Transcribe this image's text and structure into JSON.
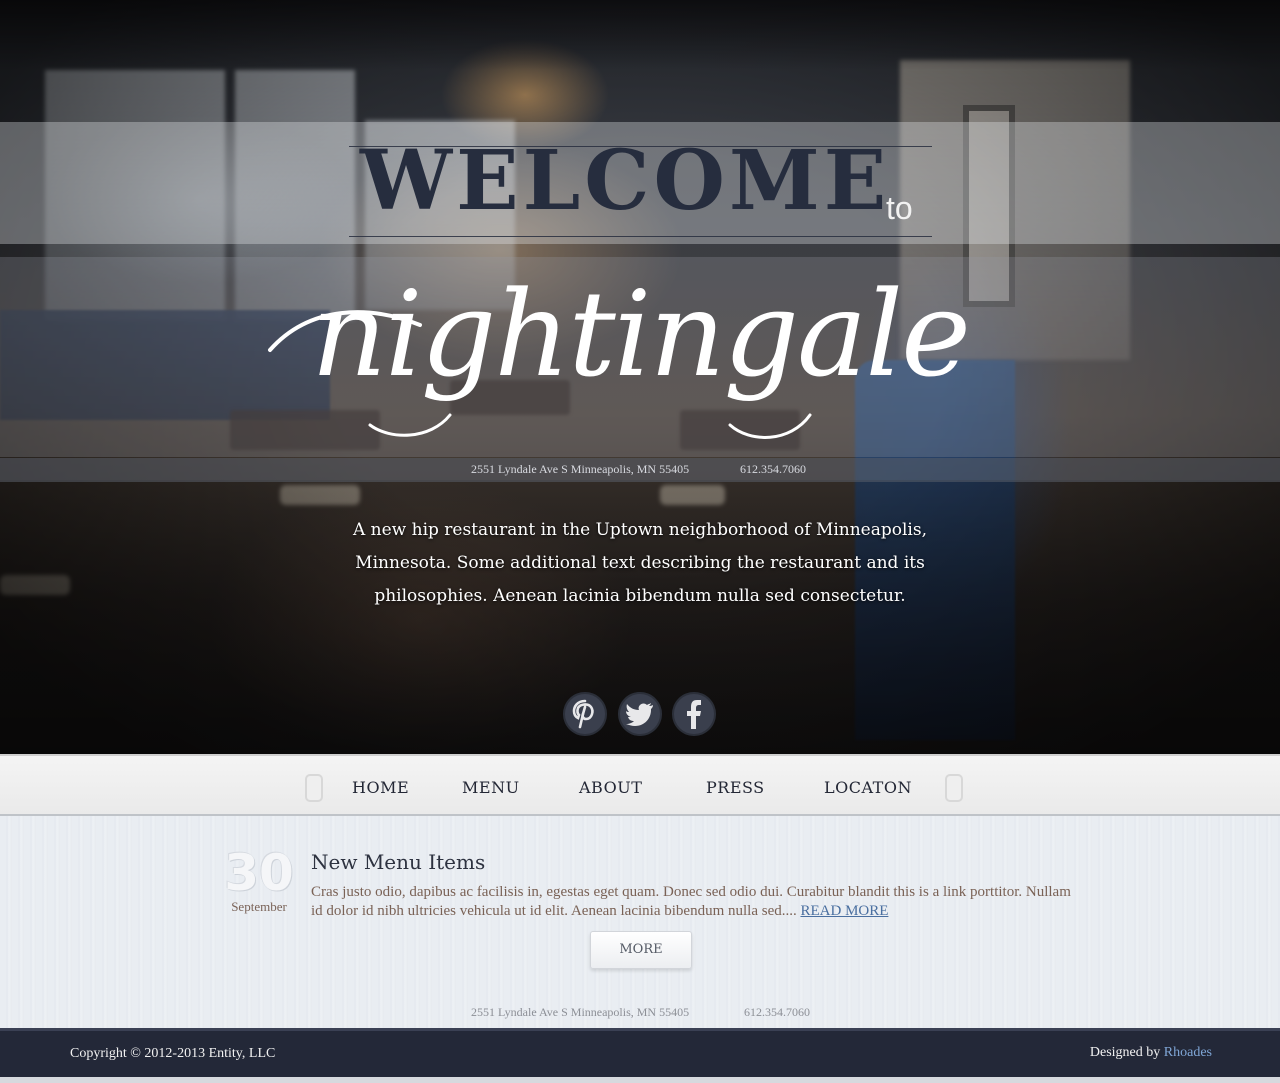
{
  "hero": {
    "welcome": "WELCOME",
    "to": "to",
    "brand_script": "nightingale",
    "address": "2551 Lyndale Ave S Minneapolis, MN 55405",
    "phone": "612.354.7060",
    "tagline_lines": [
      "A new hip restaurant in the Uptown neighborhood of Minneapolis,",
      "Minnesota. Some additional text describing the restaurant and its",
      "philosophies. Aenean lacinia bibendum nulla sed consectetur."
    ]
  },
  "social": [
    {
      "name": "pinterest-icon",
      "glyph": "P"
    },
    {
      "name": "twitter-icon",
      "glyph": "bird"
    },
    {
      "name": "facebook-icon",
      "glyph": "f"
    }
  ],
  "nav": {
    "items": [
      "HOME",
      "MENU",
      "ABOUT",
      "PRESS",
      "LOCATON"
    ]
  },
  "post": {
    "day": "30",
    "month": "September",
    "title": "New Menu Items",
    "body": "Cras justo odio, dapibus ac facilisis in, egestas eget quam. Donec sed odio dui. Curabitur blandit this is a link porttitor. Nullam id dolor id nibh ultricies vehicula ut id elit. Aenean lacinia bibendum nulla sed....",
    "read_more": "READ MORE"
  },
  "more_button": "MORE",
  "content_footer": {
    "address": "2551 Lyndale Ave S Minneapolis, MN 55405",
    "phone": "612.354.7060"
  },
  "footer": {
    "copyright": "Copyright © 2012-2013 Entity,  LLC",
    "designed_by_prefix": "Designed by",
    "designer": "Rhoades"
  },
  "colors": {
    "navy": "#262d3e",
    "footer_bg": "#232838",
    "link_blue": "#4a6fa0",
    "designer_link": "#7fa6d6"
  }
}
